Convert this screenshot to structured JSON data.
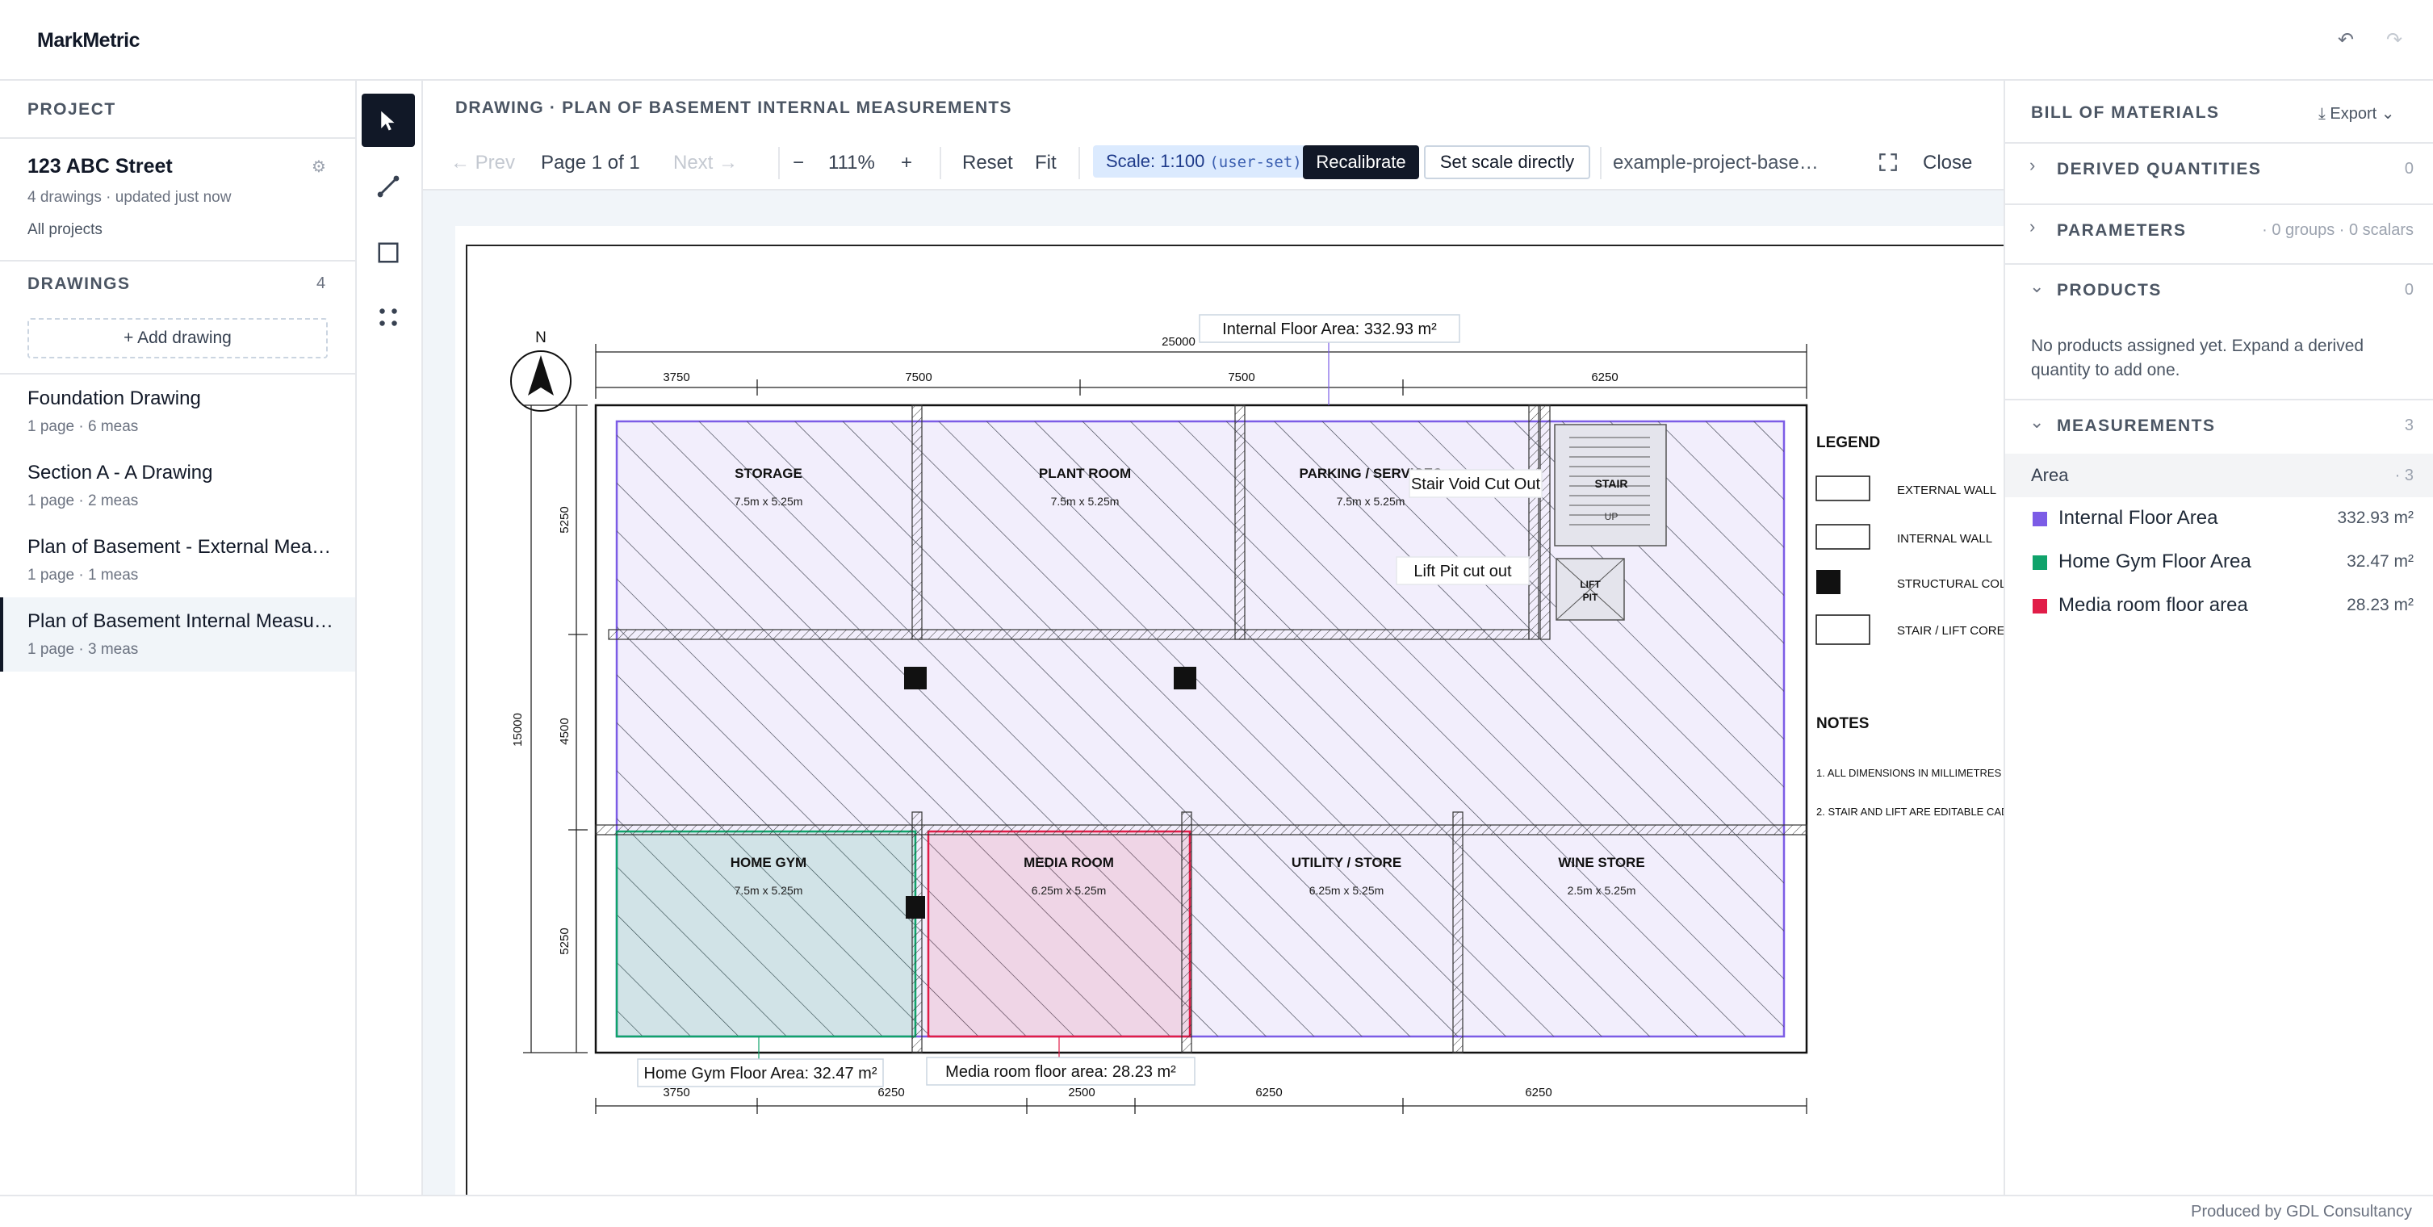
{
  "app": {
    "brand": "MarkMetric"
  },
  "sidebar": {
    "project_heading": "PROJECT",
    "project_name": "123 ABC Street",
    "project_meta": "4 drawings · updated just now",
    "all_projects": "All projects",
    "drawings_heading": "DRAWINGS",
    "drawings_count": "4",
    "add_drawing": "+ Add drawing",
    "drawings": [
      {
        "title": "Foundation Drawing",
        "meta": "1 page · 6 meas"
      },
      {
        "title": "Section A - A Drawing",
        "meta": "1 page · 2 meas"
      },
      {
        "title": "Plan of Basement - External Measurements",
        "meta": "1 page · 1 meas"
      },
      {
        "title": "Plan of Basement Internal Measurements",
        "meta": "1 page · 3 meas"
      }
    ]
  },
  "toolbar": {
    "breadcrumb": "DRAWING · PLAN OF BASEMENT INTERNAL MEASUREMENTS",
    "prev": "← Prev",
    "page": "Page 1 of 1",
    "next": "Next →",
    "zoom_out": "−",
    "zoom": "111%",
    "zoom_in": "+",
    "reset": "Reset",
    "fit": "Fit",
    "scale": "Scale: 1:100",
    "scale_note": "(user-set)",
    "recalibrate": "Recalibrate",
    "set_scale": "Set scale directly",
    "file_name": "example-project-basement-internal.pdf",
    "close": "Close"
  },
  "plan": {
    "north": "N",
    "top_dims": [
      "3750",
      "7500",
      "7500",
      "6250"
    ],
    "top_total": "25000",
    "bottom_dims": [
      "3750",
      "6250",
      "2500",
      "6250",
      "6250"
    ],
    "left_dims": [
      "5250",
      "4500",
      "5250"
    ],
    "left_total": "15000",
    "rooms": [
      {
        "name": "STORAGE",
        "size": "7.5m x 5.25m"
      },
      {
        "name": "PLANT ROOM",
        "size": "7.5m x 5.25m"
      },
      {
        "name": "PARKING / SERVICES",
        "size": "7.5m x 5.25m"
      },
      {
        "name": "HOME GYM",
        "size": "7.5m x 5.25m"
      },
      {
        "name": "MEDIA ROOM",
        "size": "6.25m x 5.25m"
      },
      {
        "name": "UTILITY / STORE",
        "size": "6.25m x 5.25m"
      },
      {
        "name": "WINE STORE",
        "size": "2.5m x 5.25m"
      }
    ],
    "stair": "STAIR",
    "stair_up": "UP",
    "lift_1": "LIFT",
    "lift_2": "PIT",
    "labels": {
      "internal_floor": "Internal Floor Area: 332.93 m²",
      "stair_void": "Stair Void Cut Out",
      "lift_pit": "Lift Pit cut out",
      "home_gym": "Home Gym Floor Area: 32.47 m²",
      "media_room": "Media room floor area: 28.23 m²"
    },
    "legend_title": "LEGEND",
    "legend": [
      "EXTERNAL WALL",
      "INTERNAL WALL",
      "STRUCTURAL COLUMN",
      "STAIR / LIFT CORE"
    ],
    "notes_title": "NOTES",
    "notes": [
      "1. ALL DIMENSIONS IN MILLIMETRES",
      "2. STAIR AND LIFT ARE EDITABLE CAD"
    ]
  },
  "bom": {
    "title": "BILL OF MATERIALS",
    "export": "⤓ Export ⌄",
    "sections": [
      {
        "label": "DERIVED QUANTITIES",
        "count": "0",
        "chevron": "›"
      },
      {
        "label": "PARAMETERS",
        "count": "· 0 groups · 0 scalars",
        "chevron": "›"
      },
      {
        "label": "PRODUCTS",
        "count": "0",
        "chevron": "⌄"
      },
      {
        "label": "MEASUREMENTS",
        "count": "3",
        "chevron": "⌄"
      }
    ],
    "products_empty": "No products assigned yet. Expand a derived quantity to add one.",
    "group_label": "Area",
    "group_count": "· 3",
    "measurements": [
      {
        "name": "Internal Floor Area",
        "value": "332.93 m²",
        "color": "#7c5ce6"
      },
      {
        "name": "Home Gym Floor Area",
        "value": "32.47 m²",
        "color": "#10a36b"
      },
      {
        "name": "Media room floor area",
        "value": "28.23 m²",
        "color": "#e11d48"
      }
    ]
  },
  "footer": {
    "credit": "Produced by GDL Consultancy"
  }
}
